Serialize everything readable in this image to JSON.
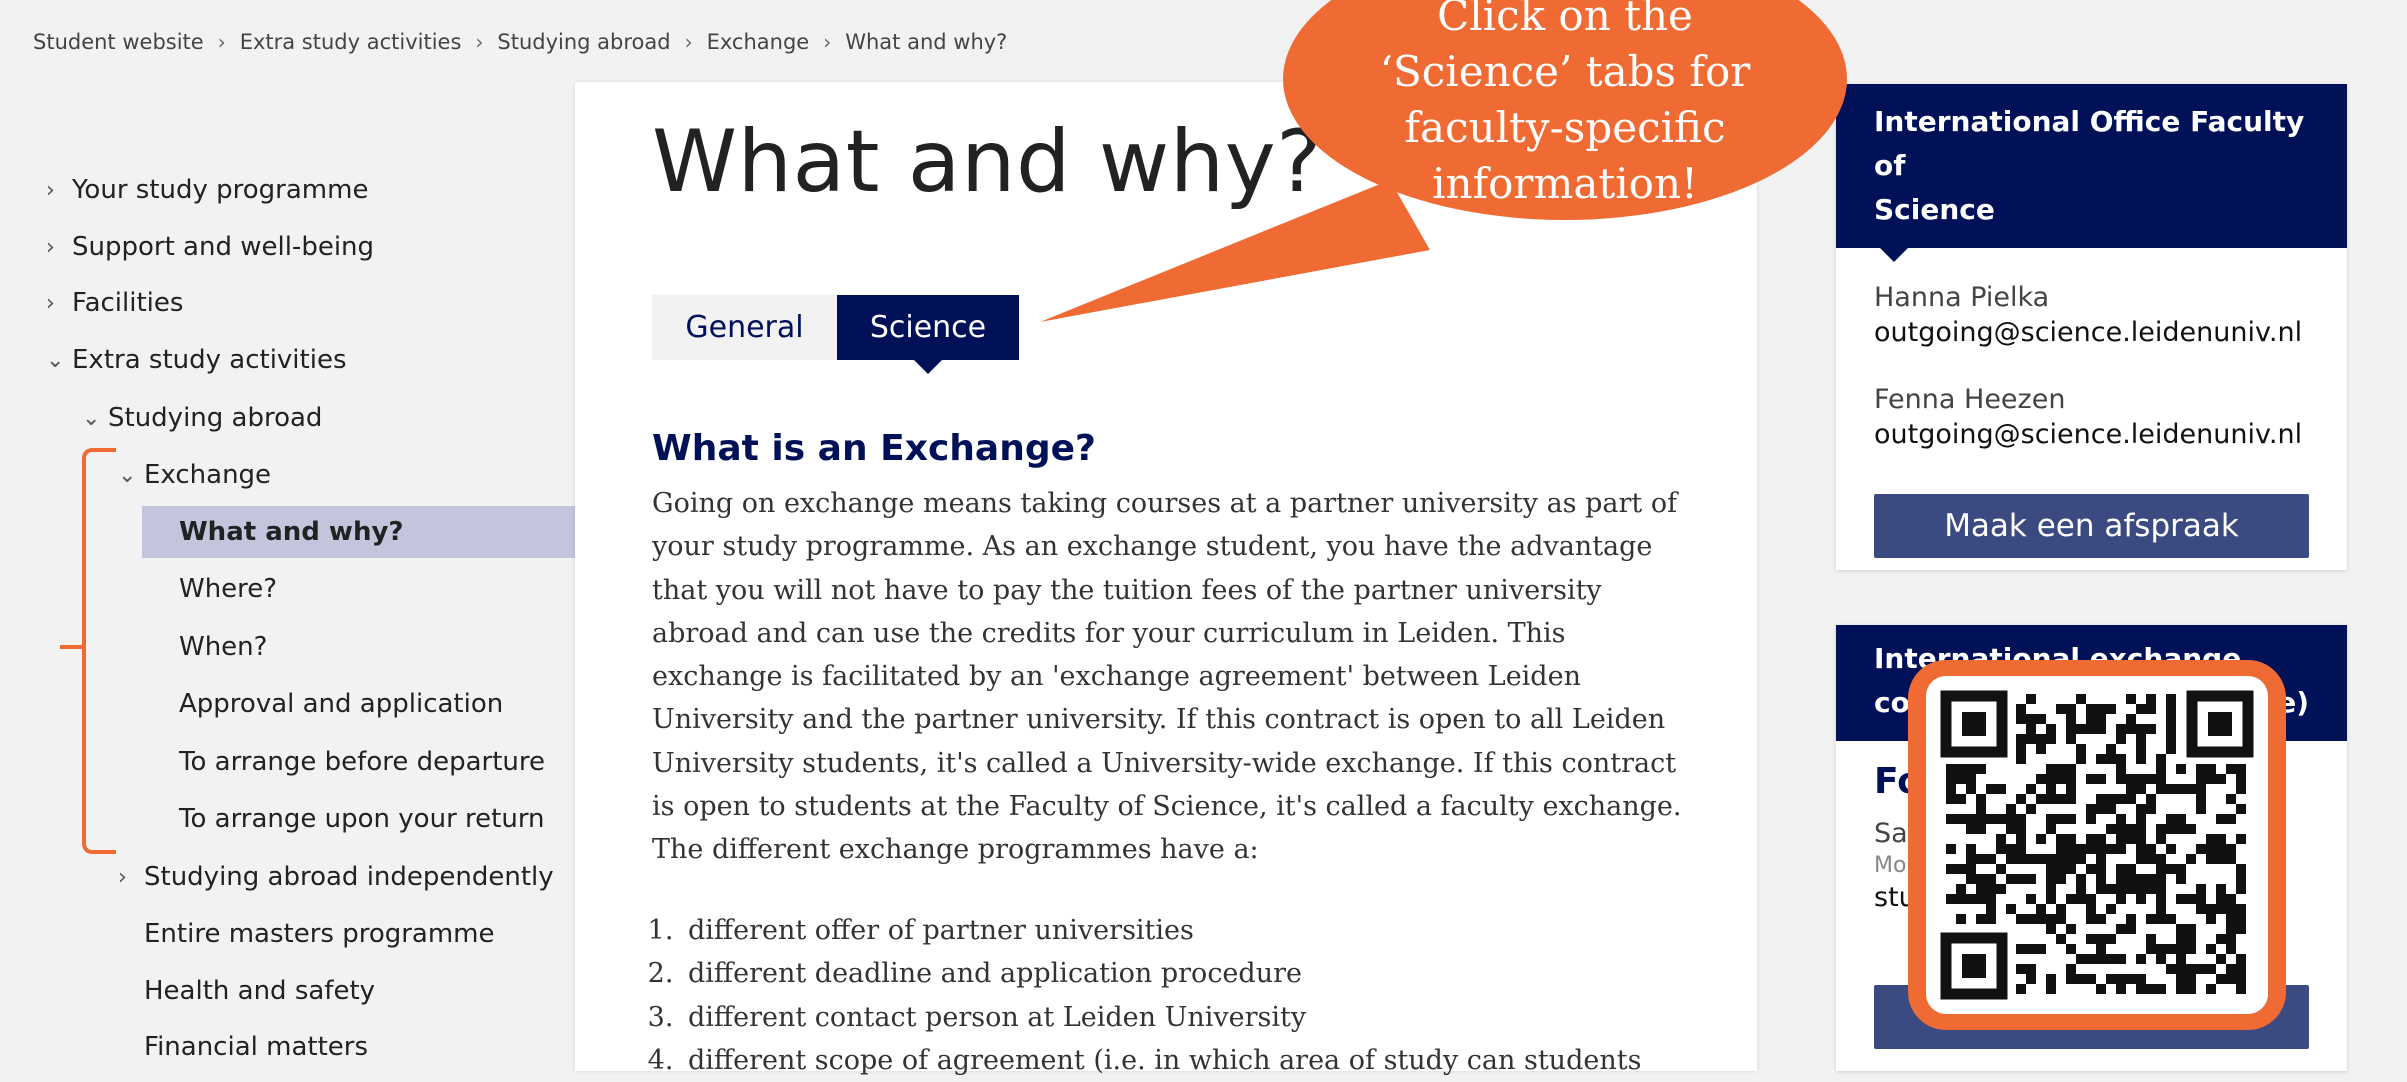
{
  "breadcrumb": [
    "Student website",
    "Extra study activities",
    "Studying abroad",
    "Exchange",
    "What and why?"
  ],
  "sidebar": {
    "items": [
      {
        "label": "Your study programme",
        "chev": "›"
      },
      {
        "label": "Support and well-being",
        "chev": "›"
      },
      {
        "label": "Facilities",
        "chev": "›"
      },
      {
        "label": "Extra study activities",
        "chev": "⌄"
      },
      {
        "label": "Studying abroad",
        "chev": "⌄"
      },
      {
        "label": "Exchange",
        "chev": "⌄"
      },
      {
        "label": "What and why?",
        "chev": ""
      },
      {
        "label": "Where?",
        "chev": ""
      },
      {
        "label": "When?",
        "chev": ""
      },
      {
        "label": "Approval and application",
        "chev": ""
      },
      {
        "label": "To arrange before departure",
        "chev": ""
      },
      {
        "label": "To arrange upon your return",
        "chev": ""
      },
      {
        "label": "Studying abroad independently",
        "chev": "›"
      },
      {
        "label": "Entire masters programme",
        "chev": ""
      },
      {
        "label": "Health and safety",
        "chev": ""
      },
      {
        "label": "Financial matters",
        "chev": ""
      }
    ]
  },
  "main": {
    "title": "What and why?",
    "tabs": {
      "general": "General",
      "science": "Science"
    },
    "section_heading": "What is an Exchange?",
    "body": "Going on exchange means taking courses at a partner university as part of your study programme. As an exchange student, you have the advantage that you will not have to pay the tuition fees of the partner university abroad and can use the credits for your curriculum in Leiden. This exchange is facilitated by an 'exchange agreement' between Leiden University and the partner university. If this contract is open to all Leiden University students, it's called a University-wide exchange. If this contract is open to students at the Faculty of Science, it's called a faculty exchange. The different exchange programmes have a:",
    "list": [
      "different offer of partner universities",
      "different deadline and application procedure",
      "different contact person at Leiden University",
      "different scope of agreement (i.e. in which area of study can students"
    ]
  },
  "callout": {
    "lines": [
      "Click on the",
      "‘Science’ tabs for",
      "faculty-specific",
      "information!"
    ]
  },
  "panel1": {
    "heading_line1": "International Office Faculty of",
    "heading_line2": "Science",
    "contacts": [
      {
        "name": "Hanna Pielka",
        "email": "outgoing@science.leidenuniv.nl"
      },
      {
        "name": "Fenna Heezen",
        "email": "outgoing@science.leidenuniv.nl"
      }
    ],
    "button": "Maak een afspraak"
  },
  "panel2": {
    "heading_line1": "International exchange",
    "heading_line2_start": "co",
    "heading_line2_end": "e)",
    "sub_heading": "Fo",
    "name_start": "Sa",
    "role_start": "Mo",
    "email_start": "stu"
  },
  "colors": {
    "navy": "#001158",
    "accent": "#ef6b33",
    "active_bg": "#c3c5dc",
    "button": "#3c4a82"
  },
  "icons": {
    "chevron": "chevron-right-icon",
    "qr": "qr-code-icon"
  }
}
